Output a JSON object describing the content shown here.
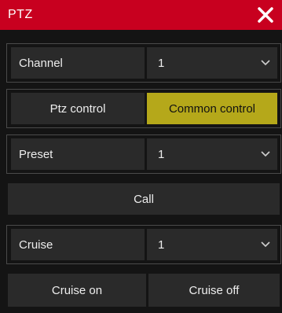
{
  "dialog": {
    "title": "PTZ",
    "close_icon": "close-icon"
  },
  "channel": {
    "label": "Channel",
    "value": "1"
  },
  "tabs": [
    {
      "label": "Ptz control",
      "active": false
    },
    {
      "label": "Common control",
      "active": true
    }
  ],
  "preset": {
    "label": "Preset",
    "value": "1"
  },
  "call_button": {
    "label": "Call"
  },
  "cruise": {
    "label": "Cruise",
    "value": "1"
  },
  "cruise_on_button": {
    "label": "Cruise on"
  },
  "cruise_off_button": {
    "label": "Cruise off"
  },
  "colors": {
    "title_bar": "#c8001f",
    "active_tab": "#b5a81a",
    "control_bg": "#2a2a2a",
    "dialog_bg": "#141414"
  }
}
